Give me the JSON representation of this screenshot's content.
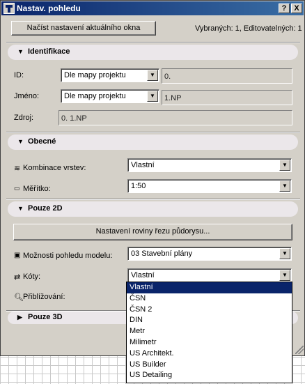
{
  "window": {
    "title": "Nastav. pohledu",
    "help_label": "?",
    "close_label": "X"
  },
  "toolbar": {
    "load_button_label": "Načíst nastavení aktuálního okna",
    "selection_info": "Vybraných: 1, Editovatelných: 1"
  },
  "sections": {
    "identification": {
      "title": "Identifikace",
      "expanded": true
    },
    "general": {
      "title": "Obecné",
      "expanded": true
    },
    "only2d": {
      "title": "Pouze 2D",
      "expanded": true
    },
    "only3d": {
      "title": "Pouze 3D",
      "expanded": false
    }
  },
  "identification": {
    "id_label": "ID:",
    "id_select": "Dle mapy projektu",
    "id_value": "0.",
    "name_label": "Jméno:",
    "name_select": "Dle mapy projektu",
    "name_value": "1.NP",
    "source_label": "Zdroj:",
    "source_value": "0. 1.NP"
  },
  "general": {
    "layers_label": "Kombinace vrstev:",
    "layers_value": "Vlastní",
    "scale_label": "Měřítko:",
    "scale_value": "1:50"
  },
  "only2d": {
    "cut_plane_button": "Nastavení roviny řezu půdorysu...",
    "model_view_label": "Možnosti pohledu modelu:",
    "model_view_value": "03 Stavební plány",
    "dimensions_label": "Kóty:",
    "dimensions_value": "Vlastní",
    "zoom_label": "Přiblížování:"
  },
  "dimensions_dropdown": {
    "selected_index": 0,
    "options": [
      "Vlastní",
      "ČSN",
      "ČSN 2",
      "DIN",
      "Metr",
      "Milimetr",
      "US Architekt.",
      "US Builder",
      "US Detailing"
    ]
  },
  "colors": {
    "titlebar_start": "#0a246a",
    "titlebar_end": "#3a6ea5",
    "dialog_bg": "#d4d0c8",
    "section_bg": "#ebe7ea",
    "selection": "#0a246a"
  },
  "icons": {
    "app": "app-icon",
    "expanded": "triangle-down-icon",
    "collapsed": "triangle-right-icon",
    "layers": "layers-icon",
    "scale": "ruler-icon",
    "model_view": "model-view-icon",
    "dimensions": "dimension-icon",
    "zoom": "magnifier-icon"
  }
}
